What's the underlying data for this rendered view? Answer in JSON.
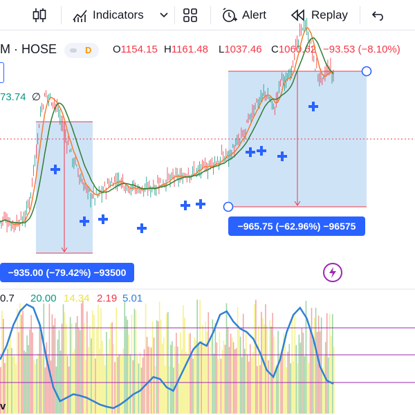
{
  "toolbar": {
    "indicators_label": "Indicators",
    "alert_label": "Alert",
    "replay_label": "Replay"
  },
  "symbol": {
    "name": "M · HOSE",
    "interval": "D",
    "open_label": "O",
    "open": "1154.15",
    "high_label": "H",
    "high": "1161.48",
    "low_label": "L",
    "low": "1037.46",
    "close_label": "C",
    "close": "1060.62",
    "change": "−93.53 (−8.10%)"
  },
  "volume": {
    "value": "73.74",
    "extra": "∅"
  },
  "measures": {
    "left": "−935.00 (−79.42%) −93500",
    "right": "−965.75 (−62.96%) −96575"
  },
  "indicator": {
    "v1": "0.7",
    "v2": "20.00",
    "v3": "14.34",
    "v4": "2.19",
    "v5": "5.01"
  },
  "colors": {
    "accent": "#2962ff",
    "down": "#f23645",
    "up": "#089981",
    "measure_fill": "#cfe3f7",
    "ma_orange": "#f57c2e",
    "ma_green": "#2e7d32",
    "osc_blue": "#2f80d6",
    "band_purple": "#9c27b0",
    "yellow": "#f5f28a"
  },
  "chart_data": {
    "type": "line",
    "price_path": [
      50,
      52,
      50,
      48,
      47,
      49,
      52,
      60,
      80,
      120,
      160,
      205,
      225,
      232,
      228,
      220,
      210,
      190,
      170,
      155,
      140,
      125,
      110,
      100,
      92,
      88,
      85,
      90,
      95,
      100,
      105,
      108,
      110,
      107,
      104,
      101,
      99,
      98,
      97,
      96,
      97,
      99,
      102,
      104,
      106,
      108,
      110,
      112,
      113,
      114,
      115,
      117,
      119,
      121,
      124,
      126,
      128,
      130,
      133,
      135,
      138,
      142,
      146,
      150,
      156,
      162,
      170,
      180,
      195,
      210,
      222,
      228,
      235,
      232,
      225,
      210,
      240,
      260,
      250,
      265,
      285,
      300,
      320,
      340,
      325,
      300,
      275,
      260,
      250,
      265,
      270,
      255
    ]
  }
}
